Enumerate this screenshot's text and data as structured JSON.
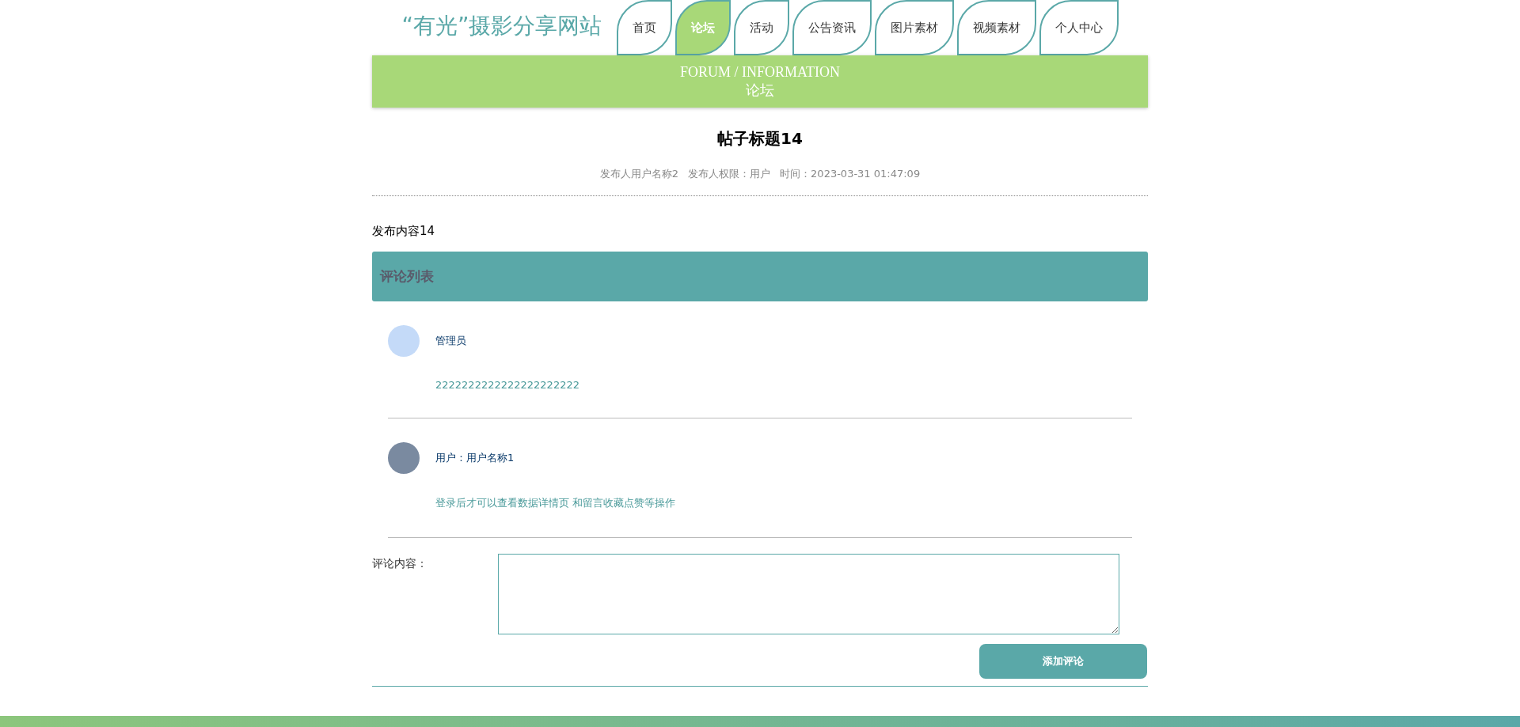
{
  "site": {
    "title": "“有光”摄影分享网站"
  },
  "nav": [
    {
      "label": "首页",
      "selected": false
    },
    {
      "label": "论坛",
      "selected": true
    },
    {
      "label": "活动",
      "selected": false
    },
    {
      "label": "公告资讯",
      "selected": false
    },
    {
      "label": "图片素材",
      "selected": false
    },
    {
      "label": "视频素材",
      "selected": false
    },
    {
      "label": "个人中心",
      "selected": false
    }
  ],
  "banner": {
    "subtitle": "FORUM / INFORMATION",
    "title": "论坛"
  },
  "post": {
    "title": "帖子标题14",
    "meta": [
      "发布人用户名称2",
      "发布人权限：用户",
      "时间：2023-03-31 01:47:09"
    ],
    "content": "发布内容14"
  },
  "comments": {
    "heading": "评论列表",
    "items": [
      {
        "kind": "default",
        "author": "管理员",
        "text": "2222222222222222222222"
      },
      {
        "kind": "photo",
        "author": "用户：用户名称1",
        "text": "登录后才可以查看数据详情页 和留言收藏点赞等操作"
      }
    ]
  },
  "form": {
    "label": "评论内容：",
    "button": "添加评论"
  }
}
